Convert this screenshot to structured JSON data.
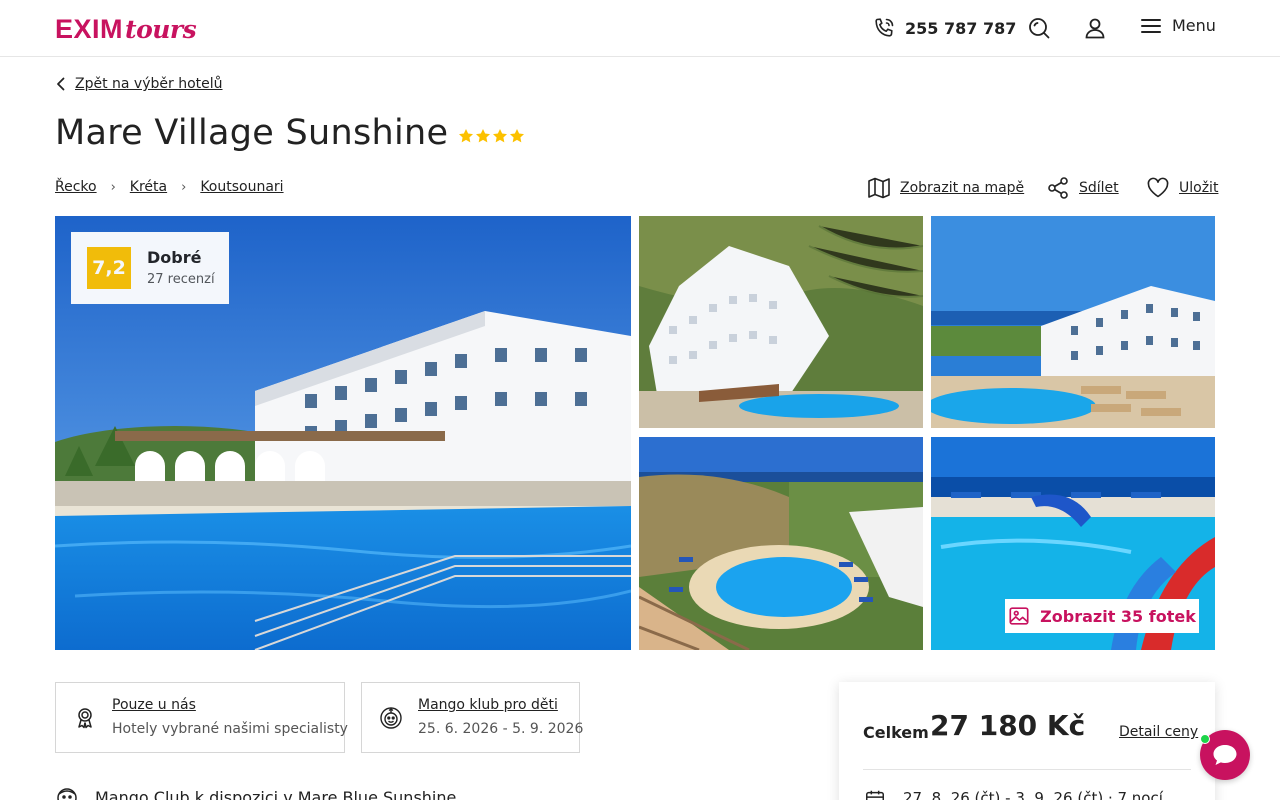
{
  "header": {
    "logo_main": "EXIM",
    "logo_sub": "tours",
    "phone": "255 787 787",
    "menu_label": "Menu"
  },
  "nav": {
    "back_label": "Zpět na výběr hotelů"
  },
  "hotel": {
    "name": "Mare Village Sunshine",
    "stars": 4,
    "breadcrumb": [
      "Řecko",
      "Kréta",
      "Koutsounari"
    ]
  },
  "actions": {
    "map_label": "Zobrazit na mapě",
    "share_label": "Sdílet",
    "save_label": "Uložit"
  },
  "rating": {
    "score": "7,2",
    "word": "Dobré",
    "count": "27 recenzí"
  },
  "gallery": {
    "show_photos_label": "Zobrazit 35 fotek"
  },
  "features": [
    {
      "title": "Pouze u nás",
      "subtitle": "Hotely vybrané našimi specialisty",
      "icon": "award-ribbon-icon"
    },
    {
      "title": "Mango klub pro děti",
      "subtitle": "25. 6. 2026 - 5. 9. 2026",
      "icon": "mango-club-icon"
    }
  ],
  "mango_note": "Mango Club k dispozici v Mare Blue Sunshine",
  "price": {
    "label": "Celkem",
    "value": "27 180 Kč",
    "detail_label": "Detail ceny",
    "dates": "27. 8. 26 (čt) - 3. 9. 26 (čt) · 7 nocí"
  },
  "colors": {
    "brand": "#c8125f",
    "rating_badge": "#fcc100",
    "star": "#fcc100",
    "chat_online": "#1ed44a"
  }
}
